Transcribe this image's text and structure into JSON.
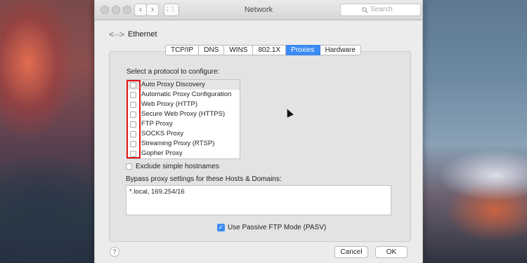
{
  "window": {
    "title": "Network"
  },
  "toolbar": {
    "back_glyph": "‹",
    "forward_glyph": "›",
    "grid_glyph": "⋮⋮⋮"
  },
  "search": {
    "placeholder": "Search",
    "icon": "search-icon"
  },
  "header": {
    "icon": "ethernet-icon",
    "icon_glyph": "<···>",
    "label": "Ethernet"
  },
  "tabs": [
    {
      "label": "TCP/IP",
      "active": false
    },
    {
      "label": "DNS",
      "active": false
    },
    {
      "label": "WINS",
      "active": false
    },
    {
      "label": "802.1X",
      "active": false
    },
    {
      "label": "Proxies",
      "active": true
    },
    {
      "label": "Hardware",
      "active": false
    }
  ],
  "proxies": {
    "select_label": "Select a protocol to configure:",
    "protocols": [
      {
        "label": "Auto Proxy Discovery",
        "checked": false
      },
      {
        "label": "Automatic Proxy Configuration",
        "checked": false
      },
      {
        "label": "Web Proxy (HTTP)",
        "checked": false
      },
      {
        "label": "Secure Web Proxy (HTTPS)",
        "checked": false
      },
      {
        "label": "FTP Proxy",
        "checked": false
      },
      {
        "label": "SOCKS Proxy",
        "checked": false
      },
      {
        "label": "Streaming Proxy (RTSP)",
        "checked": false
      },
      {
        "label": "Gopher Proxy",
        "checked": false
      }
    ],
    "exclude_label": "Exclude simple hostnames",
    "exclude_checked": false,
    "bypass_label": "Bypass proxy settings for these Hosts & Domains:",
    "bypass_value": "*.local, 169.254/16",
    "pasv_label": "Use Passive FTP Mode (PASV)",
    "pasv_checked": true
  },
  "footer": {
    "help_glyph": "?",
    "cancel_label": "Cancel",
    "ok_label": "OK"
  },
  "colors": {
    "accent": "#3b8cf3",
    "highlight_box": "#e01414"
  }
}
